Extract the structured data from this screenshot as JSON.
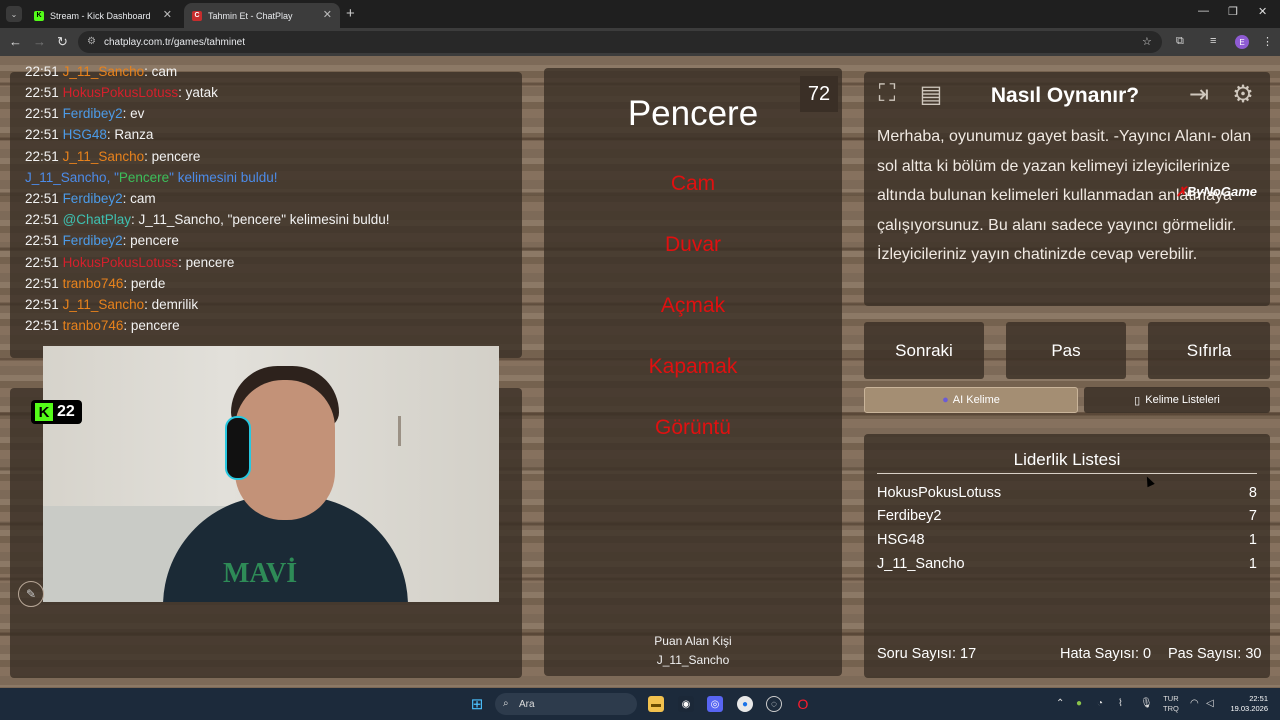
{
  "browser": {
    "tabs": [
      {
        "title": "Stream - Kick Dashboard",
        "favicon": "kick-icon",
        "active": false
      },
      {
        "title": "Tahmin Et - ChatPlay",
        "favicon": "chatplay-icon",
        "active": true
      }
    ],
    "url": "chatplay.com.tr/games/tahminet",
    "profile_initial": "E"
  },
  "chat": {
    "messages": [
      {
        "time": "22:51",
        "user": "J_11_Sancho",
        "user_color": "#e8821c",
        "text": ": cam"
      },
      {
        "time": "22:51",
        "user": "HokusPokusLotuss",
        "user_color": "#d4202c",
        "text": ": yatak"
      },
      {
        "time": "22:51",
        "user": "Ferdibey2",
        "user_color": "#4c9be8",
        "text": ": ev"
      },
      {
        "time": "22:51",
        "user": "HSG48",
        "user_color": "#4c9be8",
        "text": ": Ranza"
      },
      {
        "time": "22:51",
        "user": "J_11_Sancho",
        "user_color": "#e8821c",
        "text": ": pencere"
      },
      {
        "time": "",
        "user": "",
        "user_color": "",
        "text": ""
      },
      {
        "time": "22:51",
        "user": "Ferdibey2",
        "user_color": "#4c9be8",
        "text": ": cam"
      },
      {
        "time": "22:51",
        "user": "@ChatPlay",
        "user_color": "#3ec0b0",
        "text": ": J_11_Sancho, \"pencere\" kelimesini buldu!"
      },
      {
        "time": "22:51",
        "user": "Ferdibey2",
        "user_color": "#4c9be8",
        "text": ": pencere"
      },
      {
        "time": "22:51",
        "user": "HokusPokusLotuss",
        "user_color": "#d4202c",
        "text": ": pencere"
      },
      {
        "time": "22:51",
        "user": "tranbo746",
        "user_color": "#e8821c",
        "text": ": perde"
      },
      {
        "time": "22:51",
        "user": "J_11_Sancho",
        "user_color": "#e8821c",
        "text": ": demrilik"
      },
      {
        "time": "22:51",
        "user": "tranbo746",
        "user_color": "#e8821c",
        "text": ": pencere"
      }
    ],
    "system_line": {
      "user": "J_11_Sancho",
      "mid": ", \"",
      "word": "Pencere",
      "rest": "\" kelimesini buldu!"
    }
  },
  "stream": {
    "viewer_count": "22",
    "overlay_logo": "MAVİ"
  },
  "game": {
    "timer": "72",
    "target_word": "Pencere",
    "taboo_words": [
      "Cam",
      "Duvar",
      "Açmak",
      "Kapamak",
      "Görüntü"
    ],
    "scorer_label": "Puan Alan Kişi",
    "scorer_name": "J_11_Sancho"
  },
  "info": {
    "title": "Nasıl Oynanır?",
    "text": "Merhaba, oyunumuz gayet basit. -Yayıncı Alanı- olan sol altta ki bölüm de yazan kelimeyi izleyicilerinize altında bulunan kelimeleri kullanmadan anlatmaya çalışıyorsunuz. Bu alanı sadece yayıncı görmelidir. İzleyicileriniz yayın chatinizde cevap verebilir.",
    "sponsor_a": "By",
    "sponsor_b": "NoGame",
    "sponsor_mark": "✗"
  },
  "actions": {
    "next": "Sonraki",
    "pass": "Pas",
    "reset": "Sıfırla",
    "ai_word": "AI Kelime",
    "word_lists": "Kelime Listeleri"
  },
  "leaderboard": {
    "title": "Liderlik Listesi",
    "rows": [
      {
        "name": "HokusPokusLotuss",
        "score": "8"
      },
      {
        "name": "Ferdibey2",
        "score": "7"
      },
      {
        "name": "HSG48",
        "score": "1"
      },
      {
        "name": "J_11_Sancho",
        "score": "1"
      }
    ]
  },
  "stats": {
    "questions": "Soru Sayısı: 17",
    "errors": "Hata Sayısı: 0",
    "passes": "Pas Sayısı: 30"
  },
  "taskbar": {
    "search_placeholder": "Ara",
    "lang_top": "TUR",
    "lang_bottom": "TRQ",
    "time": "22:51",
    "date": "19.03.2026"
  },
  "colors": {
    "accent_red": "#e01010",
    "kick_green": "#53fc18",
    "panel": "#3a2f26"
  }
}
